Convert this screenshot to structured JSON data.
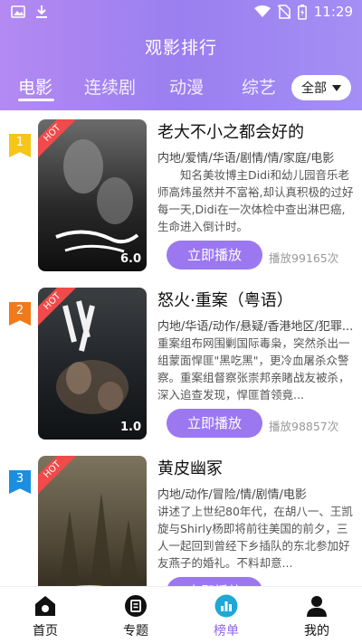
{
  "status_bar": {
    "time": "11:29"
  },
  "header": {
    "title": "观影排行",
    "tabs": [
      {
        "label": "电影",
        "active": true
      },
      {
        "label": "连续剧",
        "active": false
      },
      {
        "label": "动漫",
        "active": false
      },
      {
        "label": "综艺",
        "active": false
      }
    ],
    "filter_label": "全部"
  },
  "items": [
    {
      "rank": "1",
      "rank_color": "#f5c518",
      "badge": "HOT",
      "score": "6.0",
      "title": "老大不小之都会好的",
      "tags": "内地/爱情/华语/剧情/情/家庭/电影",
      "description": "　　知名美妆博主Didi和幼儿园音乐老师高炜虽然并不富裕,却认真积极的过好每一天,Didi在一次体检中查出淋巴癌,生命进入倒计时。",
      "play_label": "立即播放",
      "play_count": "播放99165次"
    },
    {
      "rank": "2",
      "rank_color": "#f07a1a",
      "badge": "HOT",
      "score": "1.0",
      "title": "怒火·重案（粤语）",
      "tags": "内地/华语/动作/悬疑/香港地区/犯罪...",
      "description": "重案组布网围剿国际毒枭，突然杀出一组蒙面悍匪\"黑吃黑\"，更冷血屠杀众警察。重案组督察张崇邦亲睹战友被杀，深入追查发现，悍匪首领竟...",
      "play_label": "立即播放",
      "play_count": "播放98857次"
    },
    {
      "rank": "3",
      "rank_color": "#1a8fe0",
      "badge": "HOT",
      "score": "",
      "title": "黄皮幽冢",
      "tags": "内地/动作/冒险/情/剧情/电影",
      "description": "讲述了上世纪80年代，在胡八一、王凯旋与Shirly杨即将前往美国的前夕，三人一起回到曾经下乡插队的东北参加好友燕子的婚礼。不料却意...",
      "play_label": "立即播放",
      "play_count": ""
    }
  ],
  "bottom_nav": [
    {
      "label": "首页",
      "icon": "home-icon",
      "active": false
    },
    {
      "label": "专题",
      "icon": "topic-icon",
      "active": false
    },
    {
      "label": "榜单",
      "icon": "rank-chart-icon",
      "active": true
    },
    {
      "label": "我的",
      "icon": "user-icon",
      "active": false
    }
  ]
}
